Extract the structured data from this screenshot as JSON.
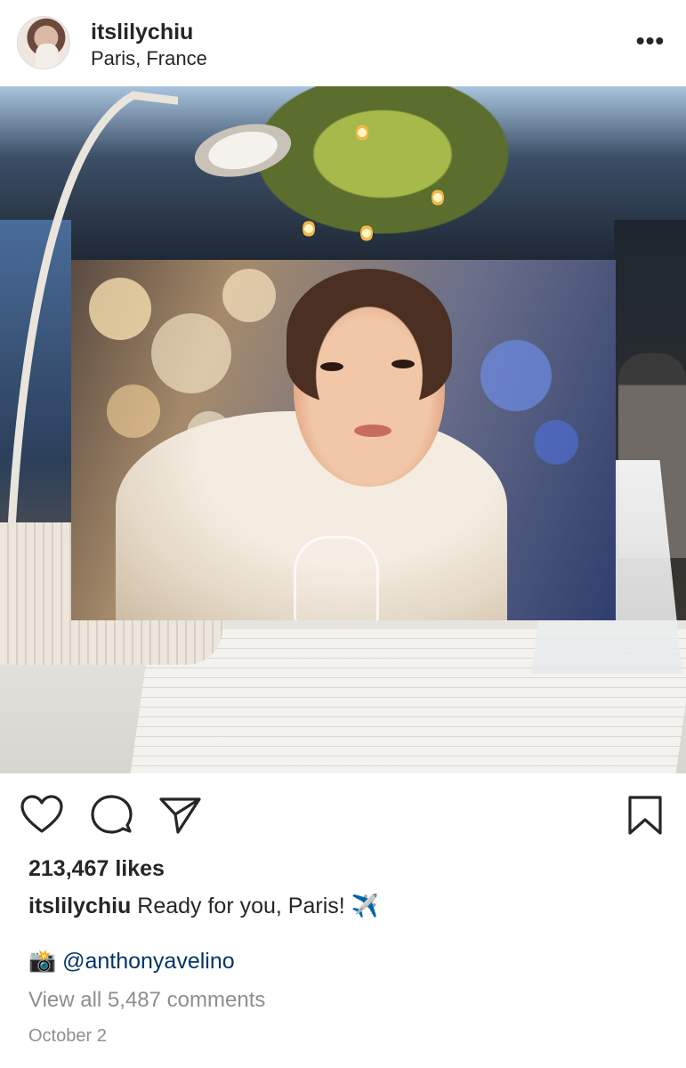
{
  "post": {
    "username": "itslilychiu",
    "location": "Paris, France",
    "more_label": "•••"
  },
  "icons": {
    "avatar": "profile-photo",
    "more": "more-options-icon",
    "like": "heart-icon",
    "comment": "comment-bubble-icon",
    "share": "paper-plane-icon",
    "save": "bookmark-icon",
    "camera": "camera-with-flash-emoji",
    "airplane": "airplane-emoji"
  },
  "engagement": {
    "likes": "213,467 likes"
  },
  "caption": {
    "username": "itslilychiu",
    "text": "Ready for you, Paris!",
    "emoji": "✈️"
  },
  "credit": {
    "emoji": "📸",
    "mention": "@anthonyavelino"
  },
  "comments": {
    "view_all": "View all 5,487 comments"
  },
  "timestamp": "October 2",
  "colors": {
    "text": "#262626",
    "secondary": "#8e8e8e",
    "link": "#003569",
    "background": "#ffffff"
  }
}
